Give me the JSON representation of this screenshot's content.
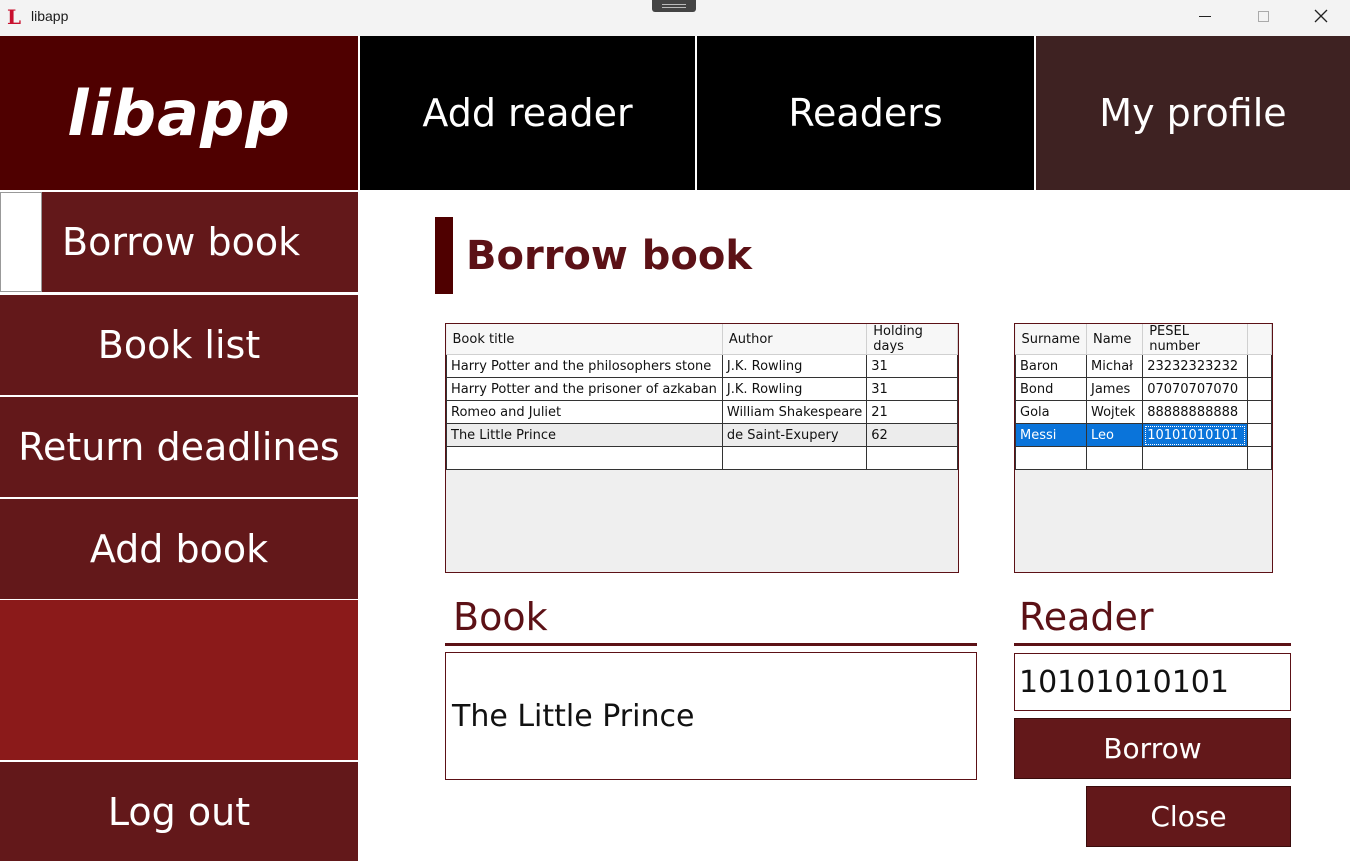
{
  "window": {
    "title": "libapp",
    "icon_letter": "L"
  },
  "logo": {
    "text": "libapp"
  },
  "topnav": {
    "add_reader": "Add reader",
    "readers": "Readers",
    "my_profile": "My profile"
  },
  "sidebar": {
    "items": [
      {
        "label": "Borrow book"
      },
      {
        "label": "Book list"
      },
      {
        "label": "Return deadlines"
      },
      {
        "label": "Add book"
      }
    ],
    "logout": "Log out"
  },
  "main": {
    "title": "Borrow book",
    "books_table": {
      "columns": [
        "Book title",
        "Author",
        "Holding days"
      ],
      "rows": [
        [
          "Harry Potter and the philosophers stone",
          "J.K. Rowling",
          "31"
        ],
        [
          "Harry Potter and the prisoner of azkaban",
          "J.K. Rowling",
          "31"
        ],
        [
          "Romeo and Juliet",
          "William Shakespeare",
          "21"
        ],
        [
          "The Little Prince",
          "de Saint-Exupery",
          "62"
        ]
      ]
    },
    "readers_table": {
      "columns": [
        "Surname",
        "Name",
        "PESEL number"
      ],
      "rows": [
        [
          "Baron",
          "Michał",
          "23232323232"
        ],
        [
          "Bond",
          "James",
          "07070707070"
        ],
        [
          "Gola",
          "Wojtek",
          "88888888888"
        ],
        [
          "Messi",
          "Leo",
          "10101010101"
        ]
      ],
      "selected_row": 3
    },
    "book_section": {
      "label": "Book",
      "value": "The Little Prince"
    },
    "reader_section": {
      "label": "Reader",
      "value": "10101010101"
    },
    "borrow_label": "Borrow",
    "close_label": "Close"
  }
}
